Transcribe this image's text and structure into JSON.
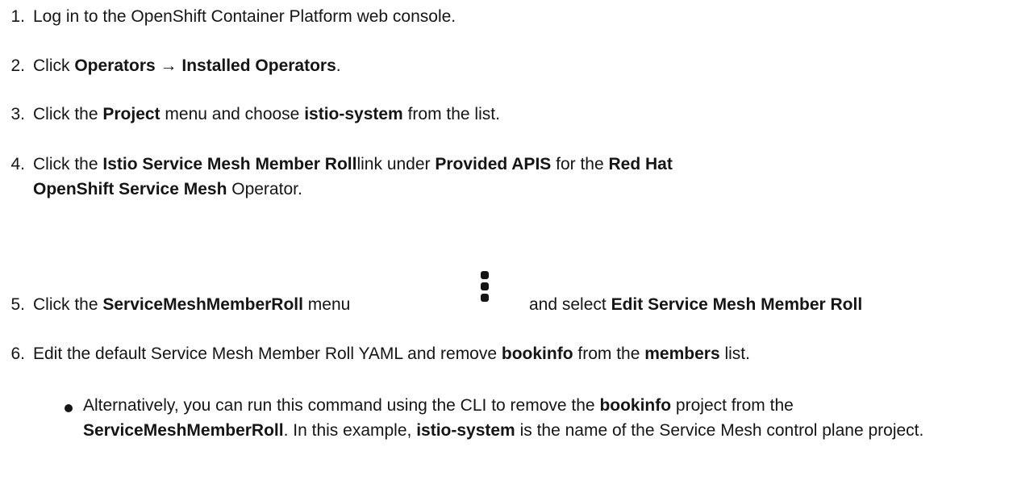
{
  "steps": [
    {
      "num": "1.",
      "text": "Log in to the OpenShift Container Platform web console."
    },
    {
      "num": "2.",
      "pre": "Click ",
      "b1": "Operators → Installed Operators",
      "post": "."
    },
    {
      "num": "3.",
      "pre": "Click the ",
      "b1": "Project",
      "mid": " menu and choose ",
      "b2": "istio-system",
      "post": " from the list."
    },
    {
      "num": "4.",
      "pre": "Click the ",
      "b1": "Istio Service Mesh Member Roll",
      "mid1": "link under ",
      "b2": "Provided APIS",
      "mid2": " for the ",
      "b3": "Red Hat OpenShift Service Mesh",
      "post": " Operator."
    },
    {
      "num": "5.",
      "pre": "Click the ",
      "b1": "ServiceMeshMemberRoll",
      "mid": " menu",
      "gap": "and select ",
      "b2": "Edit Service Mesh Member Roll",
      "icon": "kebab-menu-icon"
    },
    {
      "num": "6.",
      "pre": "Edit the default Service Mesh Member Roll YAML and remove ",
      "b1": "bookinfo",
      "mid": " from the ",
      "b2": "members",
      "post": " list."
    }
  ],
  "bullet": {
    "pre": "Alternatively, you can run this command using the CLI to remove the ",
    "b1": "bookinfo",
    "mid1": " project from the ",
    "b2": "ServiceMeshMemberRoll",
    "mid2": ". In this example, ",
    "b3": "istio-system",
    "post": " is the name of the Service Mesh control plane project."
  }
}
